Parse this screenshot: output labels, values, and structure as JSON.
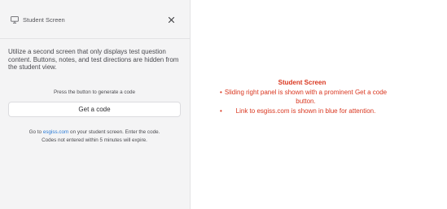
{
  "panel": {
    "title": "Student Screen",
    "header_icon": "monitor-icon",
    "close_icon": "close-icon",
    "description": "Utilize a second screen that only displays test question content. Buttons, notes, and test directions are hidden from the student view.",
    "prompt": "Press the button to generate a code",
    "button_label": "Get a code",
    "note": {
      "before_link": "Go to ",
      "link_text": "esgiss.com",
      "after_link": " on your student screen. Enter the code.",
      "line2": "Codes not entered within 5 minutes will expire."
    }
  },
  "annotation": {
    "title": "Student Screen",
    "bullets": [
      "Sliding right panel is shown with a prominent Get a code button.",
      "Link to esgiss.com is shown in blue for attention."
    ]
  },
  "colors": {
    "panel_bg": "#f4f4f5",
    "link": "#2a7ad6",
    "annotation": "#d9361f"
  }
}
